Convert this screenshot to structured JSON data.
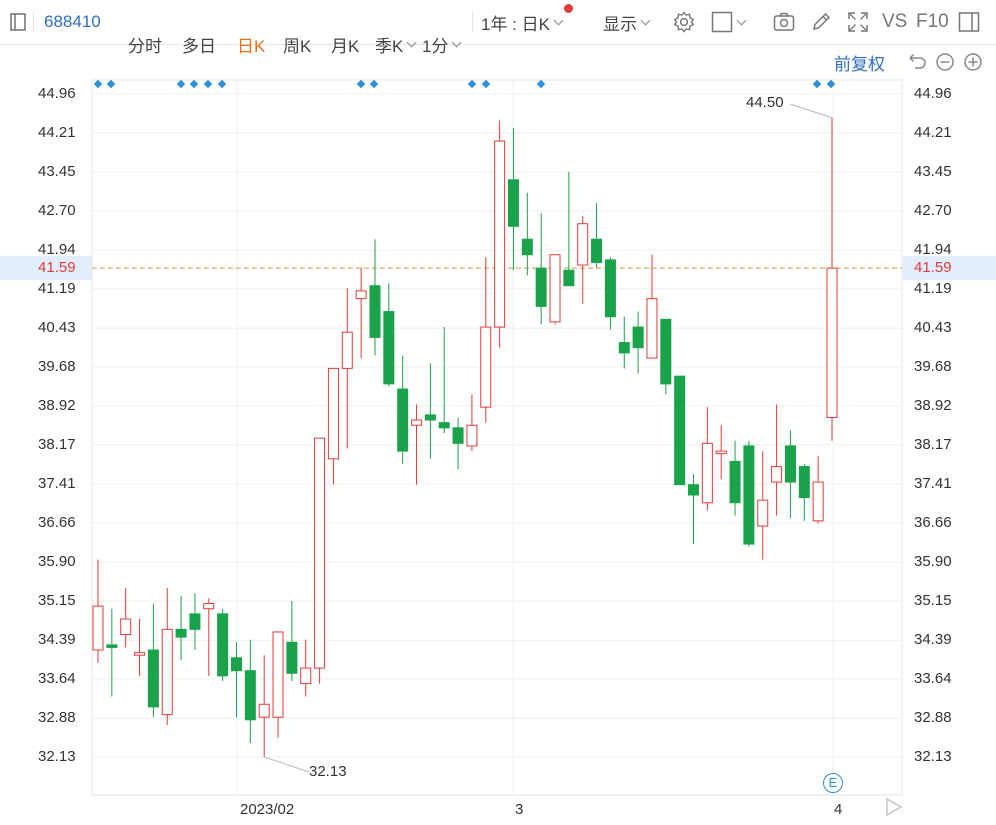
{
  "toolbar": {
    "stock_code": "688410",
    "tabs": [
      {
        "label": "分时",
        "active": false
      },
      {
        "label": "多日",
        "active": false
      },
      {
        "label": "日K",
        "active": true
      },
      {
        "label": "周K",
        "active": false
      },
      {
        "label": "月K",
        "active": false
      },
      {
        "label": "季K",
        "active": false,
        "dropdown": true
      },
      {
        "label": "1分",
        "active": false,
        "dropdown": true
      }
    ],
    "range_label": "1年 : 日K",
    "display_label": "显示",
    "vs_label": "VS",
    "f10_label": "F10",
    "icons": [
      "settings-icon",
      "checkbox-icon",
      "camera-icon",
      "edit-icon",
      "fullscreen-icon",
      "sidebar-toggle-icon"
    ]
  },
  "adjust_label": "前复权",
  "controls": [
    "undo-icon",
    "zoom-out-icon",
    "zoom-in-icon"
  ],
  "colors": {
    "up": "#e23b3b",
    "down": "#1aa34a",
    "accent": "#2f6ec7",
    "price_line": "#e0a860",
    "highlight": "#e2eefb"
  },
  "chart_data": {
    "type": "candlestick",
    "y_ticks": [
      "44.96",
      "44.21",
      "43.45",
      "42.70",
      "41.94",
      "41.19",
      "40.43",
      "39.68",
      "38.92",
      "38.17",
      "37.41",
      "36.66",
      "35.90",
      "35.15",
      "34.39",
      "33.64",
      "32.88",
      "32.13"
    ],
    "ylim": [
      32.13,
      44.96
    ],
    "x_labels": [
      "2023/02",
      "3",
      "4"
    ],
    "current_price": "41.59",
    "high_annotation": "44.50",
    "low_annotation": "32.13",
    "event_badge": "E",
    "candles": [
      {
        "o": 34.2,
        "h": 35.95,
        "l": 33.95,
        "c": 35.05
      },
      {
        "o": 34.3,
        "h": 35.0,
        "l": 33.3,
        "c": 34.25
      },
      {
        "o": 34.5,
        "h": 35.4,
        "l": 34.25,
        "c": 34.8
      },
      {
        "o": 34.1,
        "h": 34.8,
        "l": 33.7,
        "c": 34.15
      },
      {
        "o": 34.2,
        "h": 35.1,
        "l": 32.9,
        "c": 33.1
      },
      {
        "o": 32.95,
        "h": 35.4,
        "l": 32.75,
        "c": 34.6
      },
      {
        "o": 34.6,
        "h": 35.25,
        "l": 34.0,
        "c": 34.45
      },
      {
        "o": 34.9,
        "h": 35.3,
        "l": 34.2,
        "c": 34.6
      },
      {
        "o": 35.0,
        "h": 35.2,
        "l": 33.7,
        "c": 35.1
      },
      {
        "o": 34.9,
        "h": 35.0,
        "l": 33.6,
        "c": 33.7
      },
      {
        "o": 34.05,
        "h": 34.35,
        "l": 32.9,
        "c": 33.8
      },
      {
        "o": 33.8,
        "h": 34.4,
        "l": 32.4,
        "c": 32.85
      },
      {
        "o": 32.9,
        "h": 34.1,
        "l": 32.13,
        "c": 33.15
      },
      {
        "o": 32.9,
        "h": 34.5,
        "l": 32.5,
        "c": 34.55
      },
      {
        "o": 34.35,
        "h": 35.15,
        "l": 33.6,
        "c": 33.75
      },
      {
        "o": 33.55,
        "h": 34.4,
        "l": 33.3,
        "c": 33.85
      },
      {
        "o": 33.85,
        "h": 37.9,
        "l": 33.55,
        "c": 38.3
      },
      {
        "o": 37.9,
        "h": 39.6,
        "l": 37.4,
        "c": 39.65
      },
      {
        "o": 39.65,
        "h": 41.2,
        "l": 38.1,
        "c": 40.35
      },
      {
        "o": 41.0,
        "h": 41.6,
        "l": 39.85,
        "c": 41.15
      },
      {
        "o": 41.25,
        "h": 42.15,
        "l": 39.9,
        "c": 40.25
      },
      {
        "o": 40.75,
        "h": 41.3,
        "l": 39.3,
        "c": 39.35
      },
      {
        "o": 39.25,
        "h": 39.9,
        "l": 37.8,
        "c": 38.05
      },
      {
        "o": 38.55,
        "h": 38.95,
        "l": 37.4,
        "c": 38.65
      },
      {
        "o": 38.75,
        "h": 39.75,
        "l": 37.9,
        "c": 38.65
      },
      {
        "o": 38.6,
        "h": 40.45,
        "l": 38.4,
        "c": 38.5
      },
      {
        "o": 38.5,
        "h": 38.7,
        "l": 37.7,
        "c": 38.2
      },
      {
        "o": 38.15,
        "h": 39.15,
        "l": 38.05,
        "c": 38.55
      },
      {
        "o": 38.9,
        "h": 41.8,
        "l": 38.6,
        "c": 40.45
      },
      {
        "o": 40.45,
        "h": 44.45,
        "l": 40.05,
        "c": 44.05
      },
      {
        "o": 43.3,
        "h": 44.3,
        "l": 41.55,
        "c": 42.4
      },
      {
        "o": 42.15,
        "h": 43.05,
        "l": 41.45,
        "c": 41.85
      },
      {
        "o": 41.59,
        "h": 42.65,
        "l": 40.5,
        "c": 40.85
      },
      {
        "o": 40.55,
        "h": 41.85,
        "l": 40.5,
        "c": 41.85
      },
      {
        "o": 41.55,
        "h": 43.45,
        "l": 41.35,
        "c": 41.25
      },
      {
        "o": 41.65,
        "h": 42.6,
        "l": 40.9,
        "c": 42.45
      },
      {
        "o": 42.15,
        "h": 42.85,
        "l": 41.6,
        "c": 41.7
      },
      {
        "o": 41.75,
        "h": 41.8,
        "l": 40.4,
        "c": 40.65
      },
      {
        "o": 40.15,
        "h": 40.65,
        "l": 39.65,
        "c": 39.95
      },
      {
        "o": 40.45,
        "h": 40.75,
        "l": 39.55,
        "c": 40.05
      },
      {
        "o": 39.85,
        "h": 41.85,
        "l": 39.85,
        "c": 41.0
      },
      {
        "o": 40.6,
        "h": 40.55,
        "l": 39.15,
        "c": 39.35
      },
      {
        "o": 39.5,
        "h": 39.5,
        "l": 37.65,
        "c": 37.4
      },
      {
        "o": 37.4,
        "h": 37.6,
        "l": 36.25,
        "c": 37.2
      },
      {
        "o": 37.05,
        "h": 38.9,
        "l": 36.9,
        "c": 38.2
      },
      {
        "o": 38.0,
        "h": 38.55,
        "l": 37.5,
        "c": 38.05
      },
      {
        "o": 37.85,
        "h": 38.25,
        "l": 36.8,
        "c": 37.05
      },
      {
        "o": 38.15,
        "h": 38.25,
        "l": 36.2,
        "c": 36.25
      },
      {
        "o": 36.6,
        "h": 38.05,
        "l": 35.95,
        "c": 37.1
      },
      {
        "o": 37.45,
        "h": 38.95,
        "l": 36.8,
        "c": 37.75
      },
      {
        "o": 38.15,
        "h": 38.45,
        "l": 36.75,
        "c": 37.45
      },
      {
        "o": 37.75,
        "h": 37.8,
        "l": 36.7,
        "c": 37.15
      },
      {
        "o": 36.7,
        "h": 37.95,
        "l": 36.65,
        "c": 37.45
      },
      {
        "o": 38.7,
        "h": 44.5,
        "l": 38.25,
        "c": 41.59
      }
    ]
  }
}
